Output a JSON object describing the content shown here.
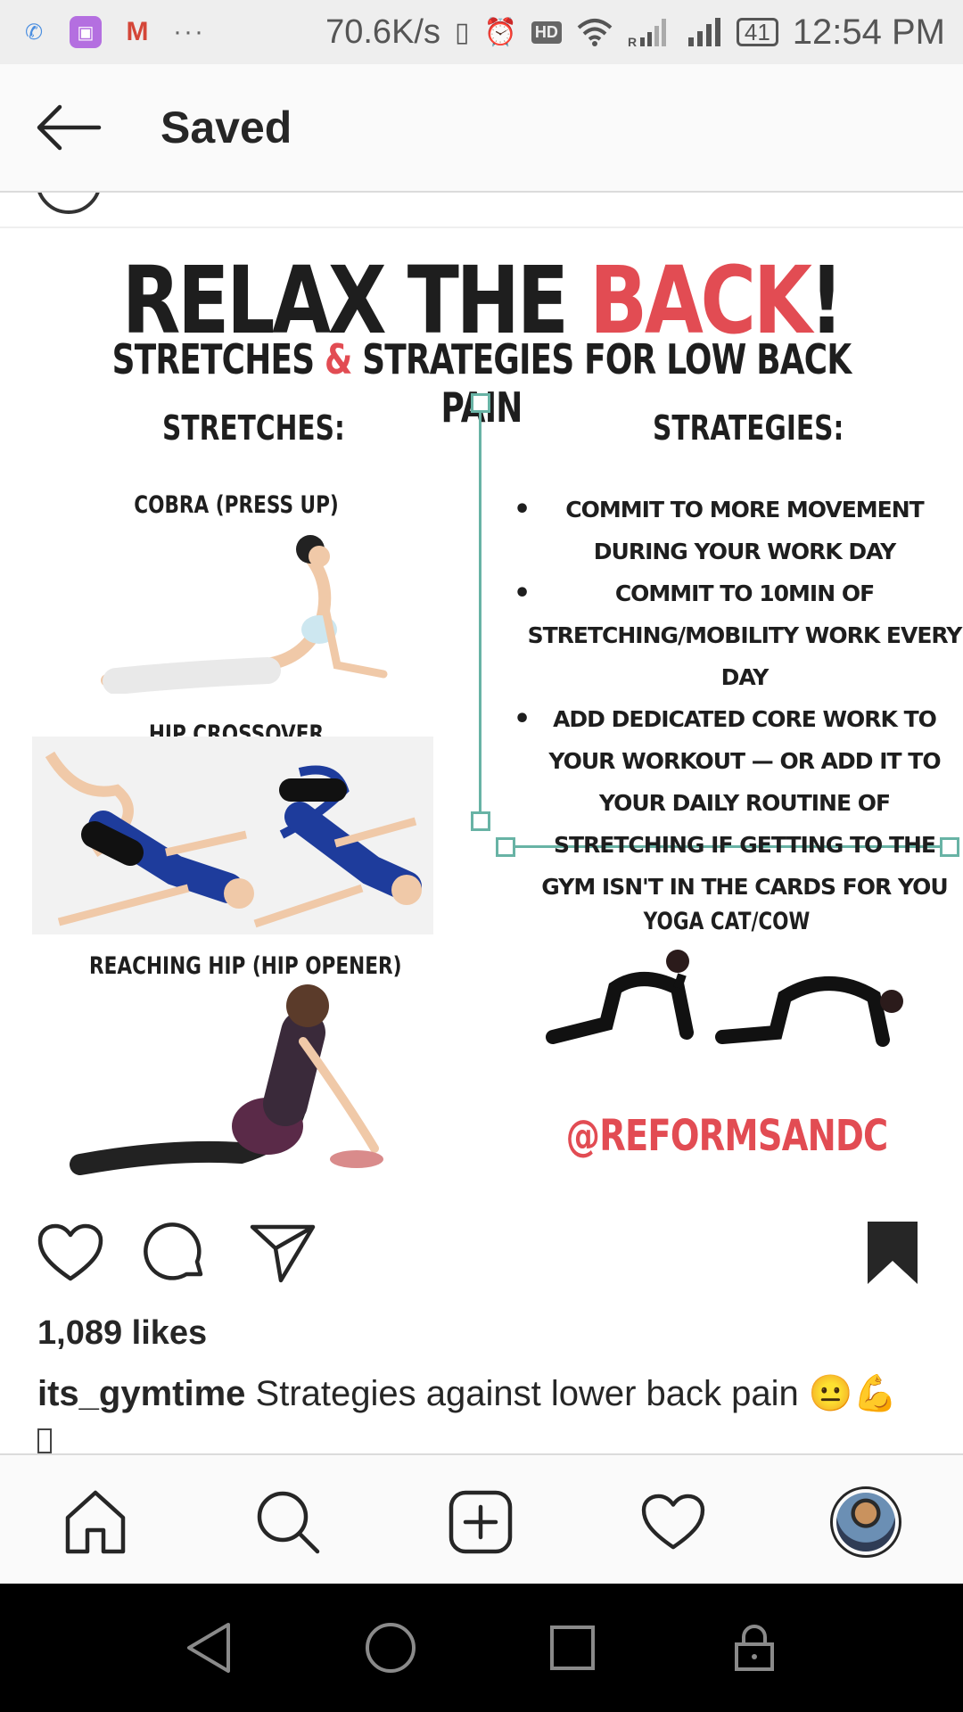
{
  "status_bar": {
    "net_speed": "70.6K/s",
    "hd": "HD",
    "battery": "41",
    "time": "12:54 PM",
    "dots": "···"
  },
  "header": {
    "title": "Saved"
  },
  "post_image": {
    "title_main": "RELAX THE ",
    "title_accent": "BACK",
    "title_end": "!",
    "subtitle_a": "STRETCHES ",
    "subtitle_amp": "&",
    "subtitle_b": " STRATEGIES FOR LOW BACK PAIN",
    "stretches_heading": "STRETCHES:",
    "strategies_heading": "STRATEGIES:",
    "exercises": {
      "cobra": "COBRA (PRESS UP)",
      "hip_crossover": "HIP CROSSOVER",
      "reaching_hip": "REACHING HIP (HIP OPENER)",
      "yoga": "YOGA CAT/COW"
    },
    "strategies": [
      "COMMIT TO MORE MOVEMENT DURING YOUR WORK DAY",
      "COMMIT TO 10MIN OF STRETCHING/MOBILITY WORK EVERY DAY",
      "ADD DEDICATED CORE WORK TO YOUR WORKOUT — OR ADD IT TO YOUR DAILY ROUTINE OF STRETCHING IF GETTING TO THE GYM ISN'T IN THE CARDS FOR YOU"
    ],
    "handle": "@REFORMSANDC"
  },
  "post": {
    "likes": "1,089 likes",
    "username": "its_gymtime",
    "caption": " Strategies against lower back pain ",
    "emojis": "😐💪"
  },
  "colors": {
    "accent_red": "#e24c53",
    "bracket_teal": "#68b3a5",
    "text": "#262626"
  },
  "icons": {
    "like": "heart-icon",
    "comment": "comment-icon",
    "share": "paper-plane-icon",
    "save": "bookmark-filled-icon",
    "nav": [
      "home-icon",
      "search-icon",
      "add-icon",
      "activity-heart-icon",
      "profile-avatar"
    ]
  }
}
